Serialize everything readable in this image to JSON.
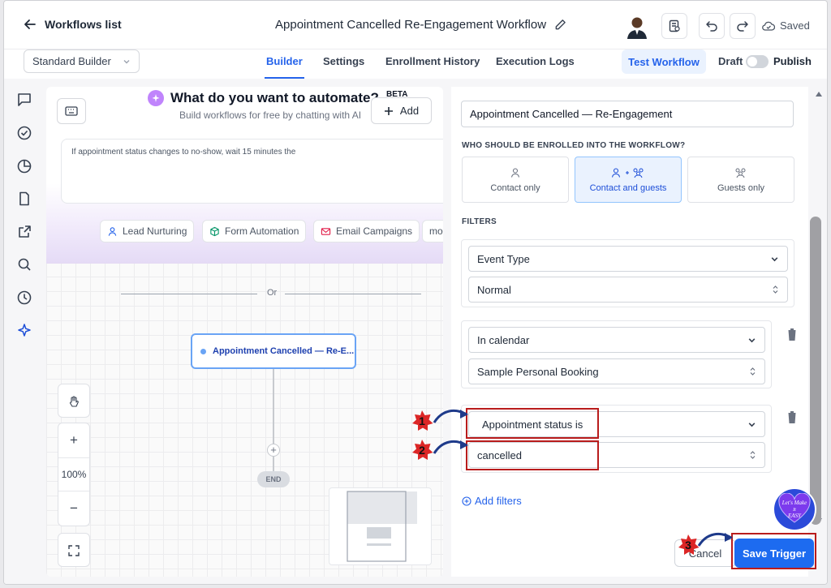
{
  "header": {
    "back_label": "Workflows list",
    "workflow_title": "Appointment Cancelled Re-Engagement Workflow",
    "saved_label": "Saved"
  },
  "subnav": {
    "builder_select": "Standard Builder",
    "tabs": [
      {
        "label": "Builder",
        "active": true
      },
      {
        "label": "Settings",
        "active": false
      },
      {
        "label": "Enrollment History",
        "active": false
      },
      {
        "label": "Execution Logs",
        "active": false
      }
    ],
    "test_workflow_label": "Test Workflow",
    "draft_label": "Draft",
    "publish_label": "Publish"
  },
  "sidebar": {
    "icons": [
      "chat-icon",
      "check-circle-icon",
      "pie-chart-icon",
      "file-icon",
      "external-link-icon",
      "search-icon",
      "history-icon",
      "sparkle-icon"
    ]
  },
  "ai_panel": {
    "title": "What do you want to automate?",
    "beta_label": "BETA",
    "subtitle": "Build workflows for free by chatting with AI",
    "add_label": "Add",
    "prompt_text": "If appointment status changes to no-show, wait 15 minutes the",
    "chips": [
      {
        "label": "Lead Nurturing"
      },
      {
        "label": "Form Automation"
      },
      {
        "label": "Email Campaigns"
      },
      {
        "label": "mo"
      }
    ]
  },
  "canvas": {
    "or_label": "Or",
    "trigger_node_label": "Appointment Cancelled — Re-E...",
    "end_label": "END",
    "zoom_in": "+",
    "zoom_level": "100%",
    "zoom_out": "−"
  },
  "trigger_panel": {
    "trigger_name": "Appointment Cancelled — Re-Engagement",
    "enroll_heading": "WHO SHOULD BE ENROLLED INTO THE WORKFLOW?",
    "enroll_options": [
      {
        "label": "Contact only",
        "selected": false
      },
      {
        "label": "Contact and guests",
        "selected": true
      },
      {
        "label": "Guests only",
        "selected": false
      }
    ],
    "filters_heading": "FILTERS",
    "filter_groups": [
      {
        "field": "Event Type",
        "value": "Normal"
      },
      {
        "field": "In calendar",
        "value": "Sample Personal Booking"
      },
      {
        "field": "Appointment status is",
        "value": "cancelled"
      }
    ],
    "add_filters_label": "Add filters",
    "cancel_label": "Cancel",
    "save_label": "Save Trigger"
  },
  "annotations": {
    "step1": "1",
    "step2": "2",
    "step3": "3",
    "watermark_lines": [
      "Let's Make",
      "It",
      "EASY"
    ]
  },
  "colors": {
    "accent": "#2563eb",
    "save_button": "#1d6bf0",
    "highlight_red": "#b91c1c",
    "selected_option_bg": "#eaf2fe"
  }
}
